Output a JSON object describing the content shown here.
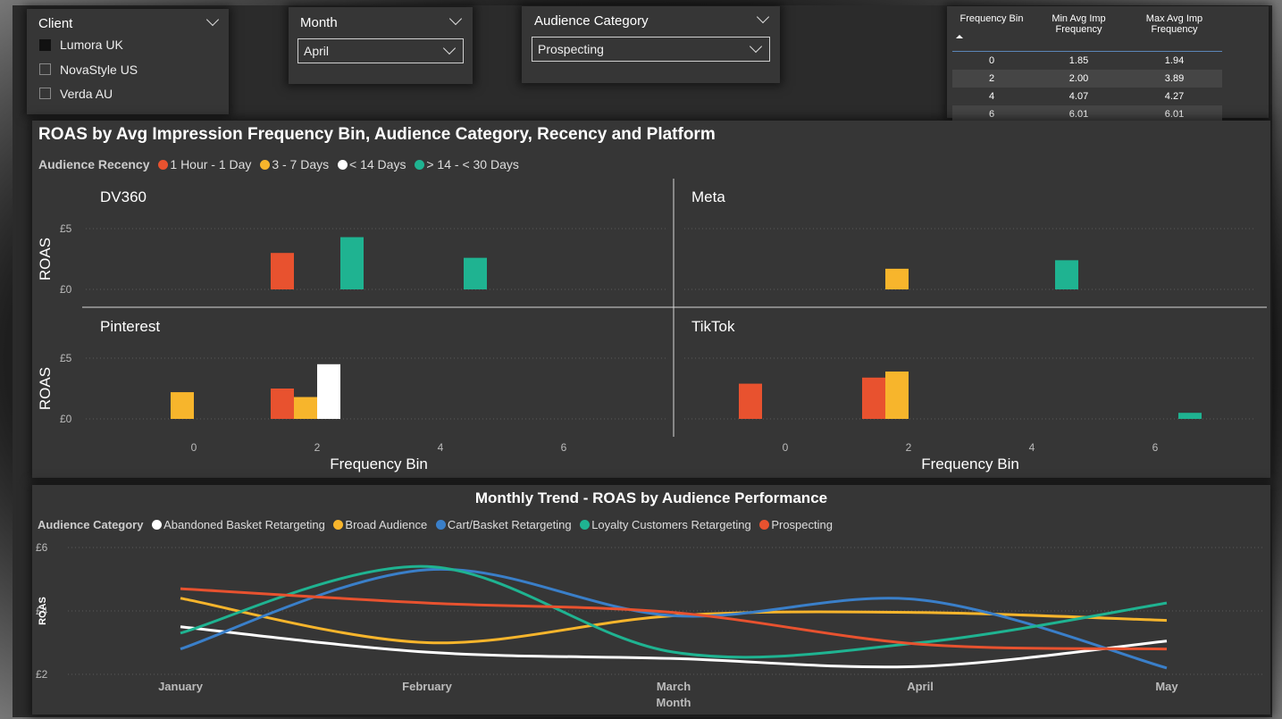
{
  "colors": {
    "recency": [
      "#e8522f",
      "#f7b52c",
      "#ffffff",
      "#1fb391"
    ],
    "categories": [
      "#ffffff",
      "#f7b52c",
      "#3a7fc9",
      "#1fb391",
      "#e8522f"
    ]
  },
  "client_slicer": {
    "title": "Client",
    "options": [
      {
        "label": "Lumora UK",
        "checked": true
      },
      {
        "label": "NovaStyle US",
        "checked": false
      },
      {
        "label": "Verda AU",
        "checked": false
      }
    ]
  },
  "month_slicer": {
    "title": "Month",
    "value": "April"
  },
  "audience_slicer": {
    "title": "Audience Category",
    "value": "Prospecting"
  },
  "freq_table": {
    "headers": [
      "Frequency Bin",
      "Min Avg Imp Frequency",
      "Max Avg Imp Frequency"
    ],
    "rows": [
      [
        "0",
        "1.85",
        "1.94"
      ],
      [
        "2",
        "2.00",
        "3.89"
      ],
      [
        "4",
        "4.07",
        "4.27"
      ],
      [
        "6",
        "6.01",
        "6.01"
      ]
    ]
  },
  "chart_data": [
    {
      "type": "bar",
      "title": "ROAS by Avg Impression Frequency Bin, Audience Category, Recency and Platform",
      "legend_title": "Audience Recency",
      "legend": [
        "1 Hour - 1 Day",
        "3 - 7 Days",
        "< 14 Days",
        "> 14 - < 30 Days"
      ],
      "xlabel": "Frequency Bin",
      "ylabel": "ROAS",
      "x_ticks": [
        "0",
        "2",
        "4",
        "6"
      ],
      "y_ticks": [
        "£0",
        "£5"
      ],
      "ylim": [
        0,
        6
      ],
      "panels": [
        {
          "name": "DV360",
          "bars": [
            {
              "x": 2,
              "s": 0,
              "v": 3.0
            },
            {
              "x": 2,
              "s": 3,
              "v": 4.3
            },
            {
              "x": 4,
              "s": 3,
              "v": 2.6
            }
          ]
        },
        {
          "name": "Meta",
          "bars": [
            {
              "x": 2,
              "s": 1,
              "v": 1.7
            },
            {
              "x": 4,
              "s": 3,
              "v": 2.4
            }
          ]
        },
        {
          "name": "Pinterest",
          "bars": [
            {
              "x": 0,
              "s": 1,
              "v": 2.2
            },
            {
              "x": 2,
              "s": 0,
              "v": 2.5
            },
            {
              "x": 2,
              "s": 1,
              "v": 1.8
            },
            {
              "x": 2,
              "s": 2,
              "v": 4.5
            }
          ]
        },
        {
          "name": "TikTok",
          "bars": [
            {
              "x": 0,
              "s": 0,
              "v": 2.9
            },
            {
              "x": 2,
              "s": 0,
              "v": 3.4
            },
            {
              "x": 2,
              "s": 1,
              "v": 3.9
            },
            {
              "x": 6,
              "s": 3,
              "v": 0.5
            }
          ]
        }
      ]
    },
    {
      "type": "line",
      "title": "Monthly Trend - ROAS by Audience Performance",
      "legend_title": "Audience Category",
      "xlabel": "Month",
      "ylabel": "ROAS",
      "categories": [
        "January",
        "February",
        "March",
        "April",
        "May"
      ],
      "y_ticks": [
        "£2",
        "£4",
        "£6"
      ],
      "ylim": [
        2,
        6
      ],
      "series": [
        {
          "name": "Abandoned Basket Retargeting",
          "values": [
            3.5,
            2.7,
            2.5,
            2.25,
            3.05
          ]
        },
        {
          "name": "Broad Audience",
          "values": [
            4.4,
            3.0,
            3.85,
            3.95,
            3.7
          ]
        },
        {
          "name": "Cart/Basket Retargeting",
          "values": [
            2.8,
            5.3,
            3.85,
            4.35,
            2.2
          ]
        },
        {
          "name": "Loyalty Customers Retargeting",
          "values": [
            3.3,
            5.4,
            2.7,
            3.0,
            4.25
          ]
        },
        {
          "name": "Prospecting",
          "values": [
            4.7,
            4.25,
            3.95,
            2.95,
            2.8
          ]
        }
      ]
    }
  ]
}
